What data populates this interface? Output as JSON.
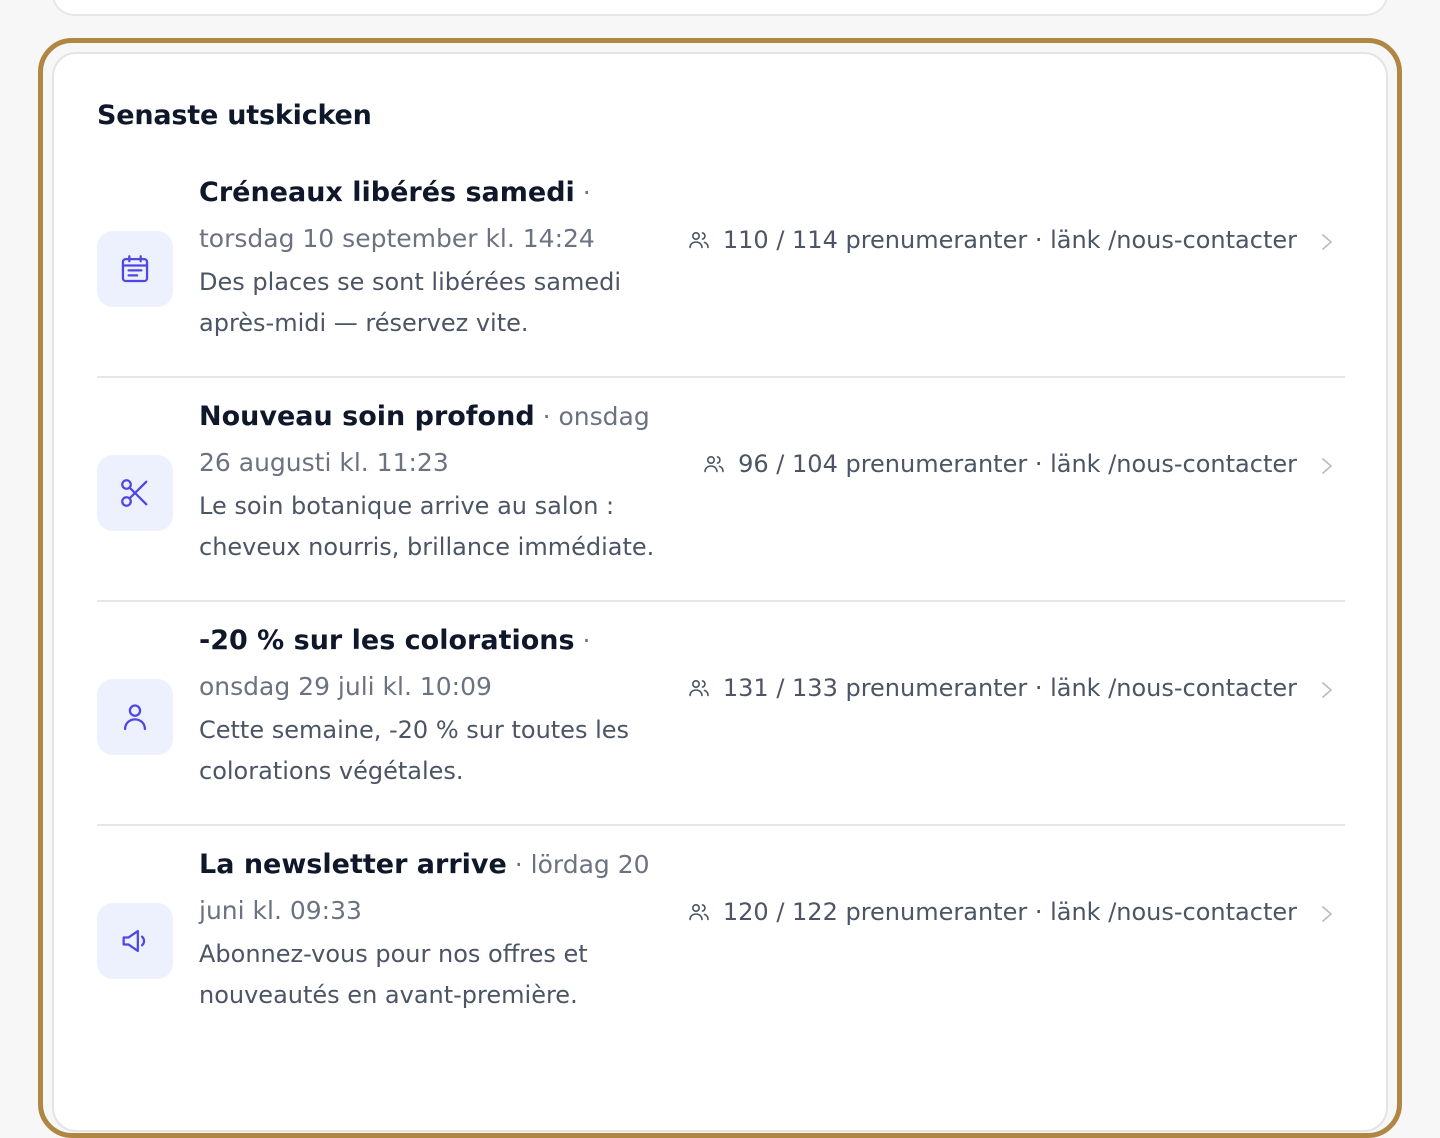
{
  "card": {
    "title": "Senaste utskicken"
  },
  "items": [
    {
      "title": "Créneaux libérés samedi",
      "date": " · torsdag 10 september kl. 14:24",
      "snippet": "Des places se sont libérées samedi après-midi — réservez vite.",
      "stats": "110 / 114 prenumeranter · länk /nous-contacter",
      "icon": "calendar-icon"
    },
    {
      "title": "Nouveau soin profond",
      "date": " · onsdag 26 augusti kl. 11:23",
      "snippet": "Le soin botanique arrive au salon : cheveux nourris, brillance immédiate.",
      "stats": "96 / 104 prenumeranter · länk /nous-contacter",
      "icon": "scissors-icon"
    },
    {
      "title": "-20 % sur les colorations",
      "date": " · onsdag 29 juli kl. 10:09",
      "snippet": "Cette semaine, -20 % sur toutes les colorations végétales.",
      "stats": "131 / 133 prenumeranter · länk /nous-contacter",
      "icon": "user-icon"
    },
    {
      "title": "La newsletter arrive",
      "date": " · lördag 20 juni kl. 09:33",
      "snippet": "Abonnez-vous pour nos offres et nouveautés en avant-première.",
      "stats": "120 / 122 prenumeranter · länk /nous-contacter",
      "icon": "megaphone-icon"
    }
  ],
  "colors": {
    "accent": "#4f46e5",
    "icon_bg": "#edf0fd",
    "focus_ring": "#b08742"
  }
}
